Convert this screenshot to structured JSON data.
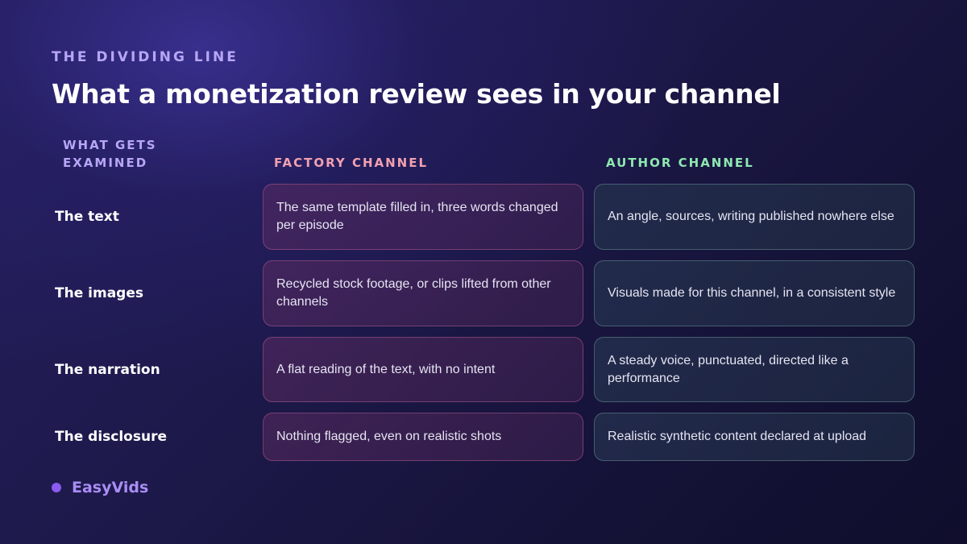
{
  "kicker": "THE DIVIDING LINE",
  "title": "What a monetization review sees in your channel",
  "columns": {
    "criteria": "WHAT GETS EXAMINED",
    "factory": "FACTORY CHANNEL",
    "author": "AUTHOR CHANNEL"
  },
  "rows": [
    {
      "label": "The text",
      "factory": "The same template filled in, three words changed per episode",
      "author": "An angle, sources, writing published nowhere else"
    },
    {
      "label": "The images",
      "factory": "Recycled stock footage, or clips lifted from other channels",
      "author": "Visuals made for this channel, in a consistent style"
    },
    {
      "label": "The narration",
      "factory": "A flat reading of the text, with no intent",
      "author": "A steady voice, punctuated, directed like a performance"
    },
    {
      "label": "The disclosure",
      "factory": "Nothing flagged, even on realistic shots",
      "author": "Realistic synthetic content declared at upload"
    }
  ],
  "brand": {
    "name": "EasyVids"
  },
  "colors": {
    "kicker": "#b7a6f5",
    "factory_accent": "#f2a0b0",
    "author_accent": "#8ee8b0",
    "brand_dot": "#8a5cf0"
  }
}
